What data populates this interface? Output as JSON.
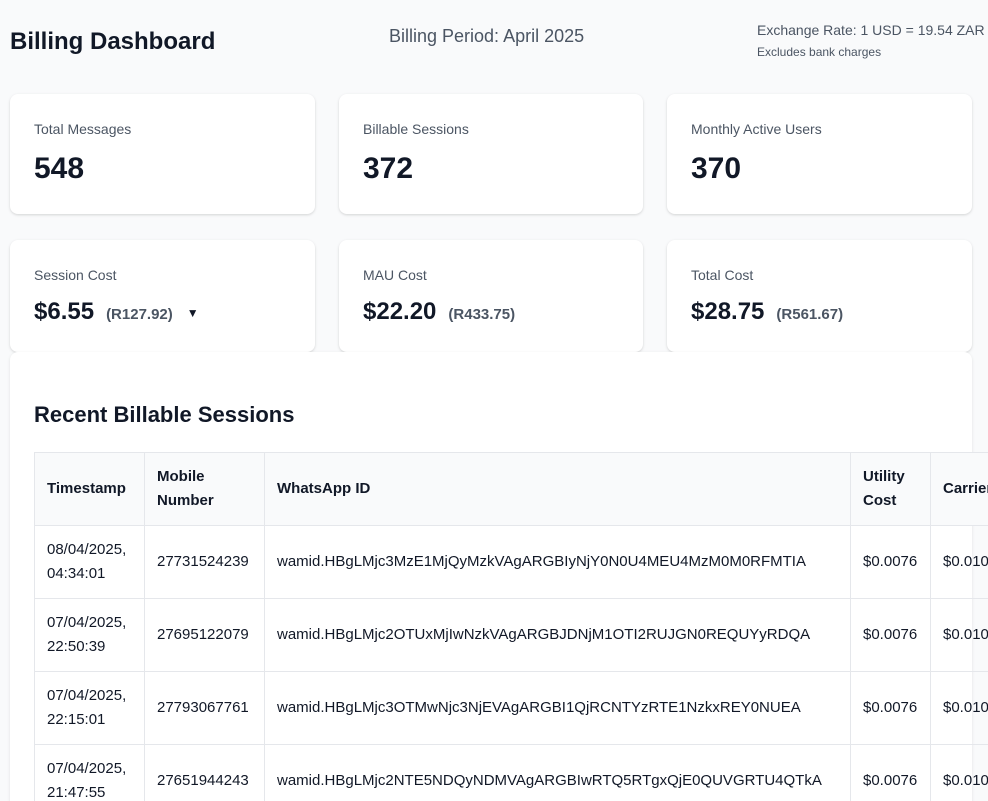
{
  "header": {
    "title": "Billing Dashboard",
    "period": "Billing Period: April 2025",
    "exchange_rate": "Exchange Rate: 1 USD = 19.54 ZAR",
    "exchange_note": "Excludes bank charges"
  },
  "stats": [
    {
      "label": "Total Messages",
      "value": "548"
    },
    {
      "label": "Billable Sessions",
      "value": "372"
    },
    {
      "label": "Monthly Active Users",
      "value": "370"
    }
  ],
  "costs": [
    {
      "label": "Session Cost",
      "usd": "$6.55",
      "zar": "(R127.92)",
      "caret": "▼"
    },
    {
      "label": "MAU Cost",
      "usd": "$22.20",
      "zar": "(R433.75)"
    },
    {
      "label": "Total Cost",
      "usd": "$28.75",
      "zar": "(R561.67)"
    }
  ],
  "sessions": {
    "title": "Recent Billable Sessions",
    "columns": [
      "Timestamp",
      "Mobile Number",
      "WhatsApp ID",
      "Utility Cost",
      "Carrier Cost"
    ],
    "rows": [
      {
        "timestamp": "08/04/2025, 04:34:01",
        "mobile": "27731524239",
        "whatsapp_id": "wamid.HBgLMjc3MzE1MjQyMzkVAgARGBIyNjY0N0U4MEU4MzM0M0RFMTIA",
        "utility": "$0.0076",
        "carrier": "$0.010"
      },
      {
        "timestamp": "07/04/2025, 22:50:39",
        "mobile": "27695122079",
        "whatsapp_id": "wamid.HBgLMjc2OTUxMjIwNzkVAgARGBJDNjM1OTI2RUJGN0REQUYyRDQA",
        "utility": "$0.0076",
        "carrier": "$0.010"
      },
      {
        "timestamp": "07/04/2025, 22:15:01",
        "mobile": "27793067761",
        "whatsapp_id": "wamid.HBgLMjc3OTMwNjc3NjEVAgARGBI1QjRCNTYzRTE1NzkxREY0NUEA",
        "utility": "$0.0076",
        "carrier": "$0.010"
      },
      {
        "timestamp": "07/04/2025, 21:47:55",
        "mobile": "27651944243",
        "whatsapp_id": "wamid.HBgLMjc2NTE5NDQyNDMVAgARGBIwRTQ5RTgxQjE0QUVGRTU4QTkA",
        "utility": "$0.0076",
        "carrier": "$0.010"
      }
    ]
  }
}
